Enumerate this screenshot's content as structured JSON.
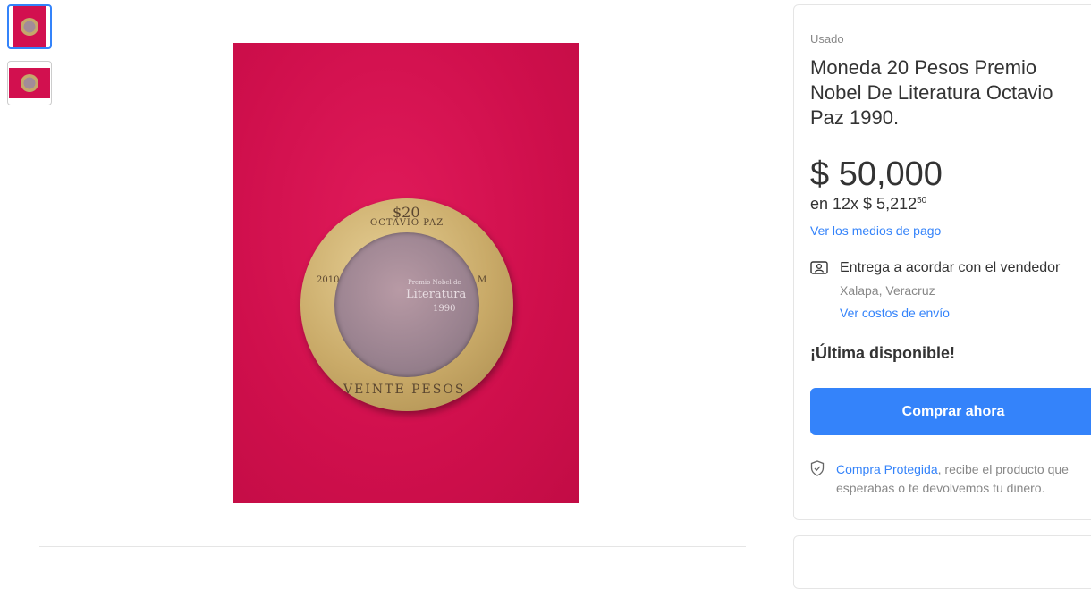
{
  "gallery": {
    "thumbnails": [
      {
        "alt": "coin photo 1"
      },
      {
        "alt": "coin photo 2"
      }
    ],
    "main_photo": {
      "coin_denomination": "$20",
      "coin_top_text": "OCTAVIO PAZ",
      "coin_year": "2010",
      "coin_mint": "M",
      "coin_center_text_1": "Premio Nobel de",
      "coin_center_text_2": "Literatura",
      "coin_center_text_3": "1990",
      "coin_bottom_text": "VEINTE PESOS",
      "background_color": "#d2104f"
    }
  },
  "product": {
    "condition": "Usado",
    "title": "Moneda 20 Pesos Premio Nobel De Literatura Octavio Paz 1990.",
    "price": "$ 50,000",
    "installments_prefix": "en 12x $ 5,212",
    "installments_cents": "50",
    "payment_link": "Ver los medios de pago",
    "shipping_text": "Entrega a acordar con el vendedor",
    "shipping_location": "Xalapa, Veracruz",
    "shipping_link": "Ver costos de envío",
    "stock_text": "¡Última disponible!",
    "buy_button": "Comprar ahora",
    "protection_link": "Compra Protegida",
    "protection_text": ", recibe el producto que esperabas o te devolvemos tu dinero."
  },
  "colors": {
    "accent": "#3483fa",
    "text": "#333333",
    "muted": "#888888"
  }
}
